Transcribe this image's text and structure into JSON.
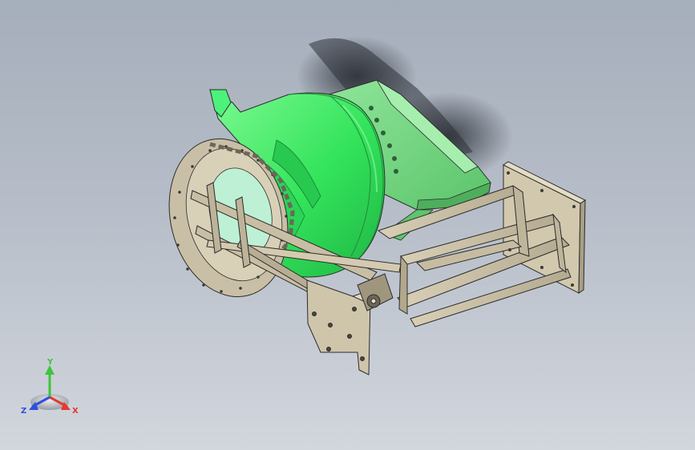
{
  "viewport": {
    "background_top": "#a5aebb",
    "background_bottom": "#d2d6dd"
  },
  "model": {
    "turbine_color": "#3bea63",
    "housing_color": "#6fd67a",
    "frame_color": "#ccc2a8",
    "frame_shadow": "#8f8670",
    "edge_color": "#2b2b2b"
  },
  "triad": {
    "x_label": "X",
    "y_label": "Y",
    "z_label": "Z",
    "x_color": "#e23a2e",
    "y_color": "#3ec43e",
    "z_color": "#2f4fe0"
  }
}
